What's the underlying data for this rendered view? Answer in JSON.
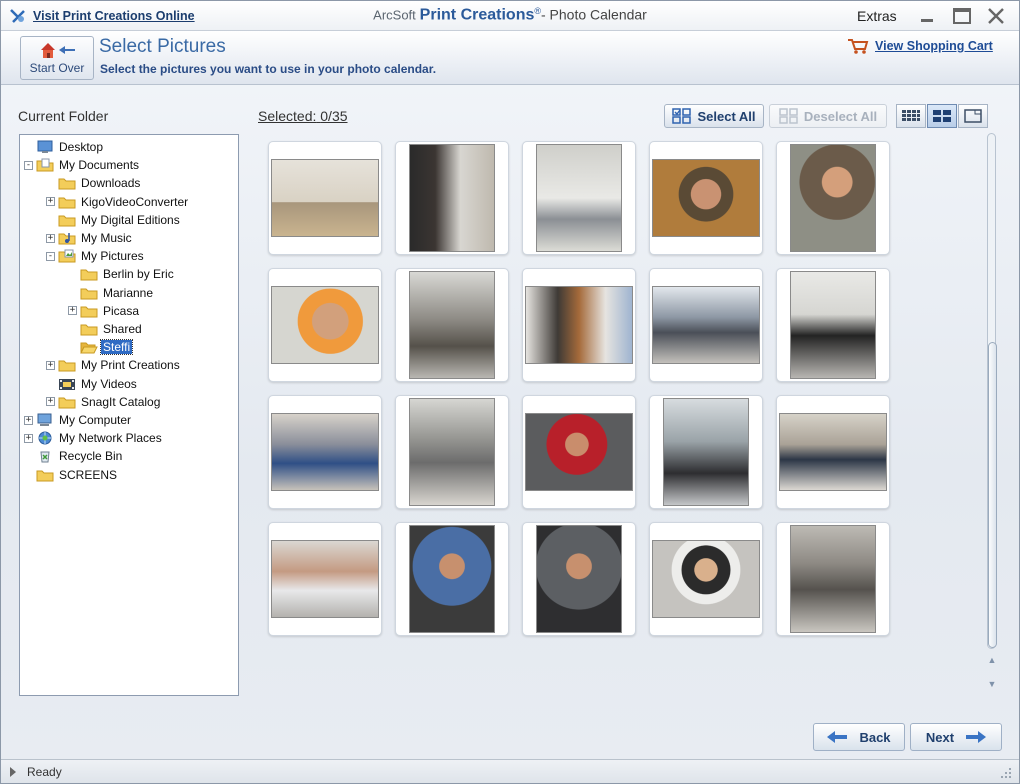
{
  "titlebar": {
    "visit_link": "Visit Print Creations Online",
    "brand_prefix": "ArcSoft",
    "brand_name": "Print Creations",
    "brand_mark": "®",
    "suffix": "- Photo Calendar",
    "extras": "Extras"
  },
  "header": {
    "start_over": "Start Over",
    "title": "Select Pictures",
    "subtitle": "Select the pictures you want to use in your photo calendar.",
    "cart_link": "View Shopping Cart"
  },
  "folders": {
    "label": "Current Folder",
    "items": [
      {
        "label": "Desktop"
      },
      {
        "label": "My Documents"
      },
      {
        "label": "Downloads"
      },
      {
        "label": "KigoVideoConverter"
      },
      {
        "label": "My Digital Editions"
      },
      {
        "label": "My Music"
      },
      {
        "label": "My Pictures"
      },
      {
        "label": "Berlin by Eric"
      },
      {
        "label": "Marianne"
      },
      {
        "label": "Picasa"
      },
      {
        "label": "Shared"
      },
      {
        "label": "Steffi"
      },
      {
        "label": "My Print Creations"
      },
      {
        "label": "My Videos"
      },
      {
        "label": "SnagIt Catalog"
      },
      {
        "label": "My Computer"
      },
      {
        "label": "My Network Places"
      },
      {
        "label": "Recycle Bin"
      },
      {
        "label": "SCREENS"
      }
    ],
    "selected": "Steffi"
  },
  "toolbar": {
    "selected_label": "Selected:",
    "selected_count": "0/35",
    "select_all": "Select All",
    "deselect_all": "Deselect All"
  },
  "photos": {
    "count_visible": 20
  },
  "navigation": {
    "back": "Back",
    "next": "Next"
  },
  "status": {
    "text": "Ready"
  },
  "colors": {
    "accent": "#2b5a9a",
    "selection": "#2f6bc4",
    "link": "#1e4c96"
  }
}
